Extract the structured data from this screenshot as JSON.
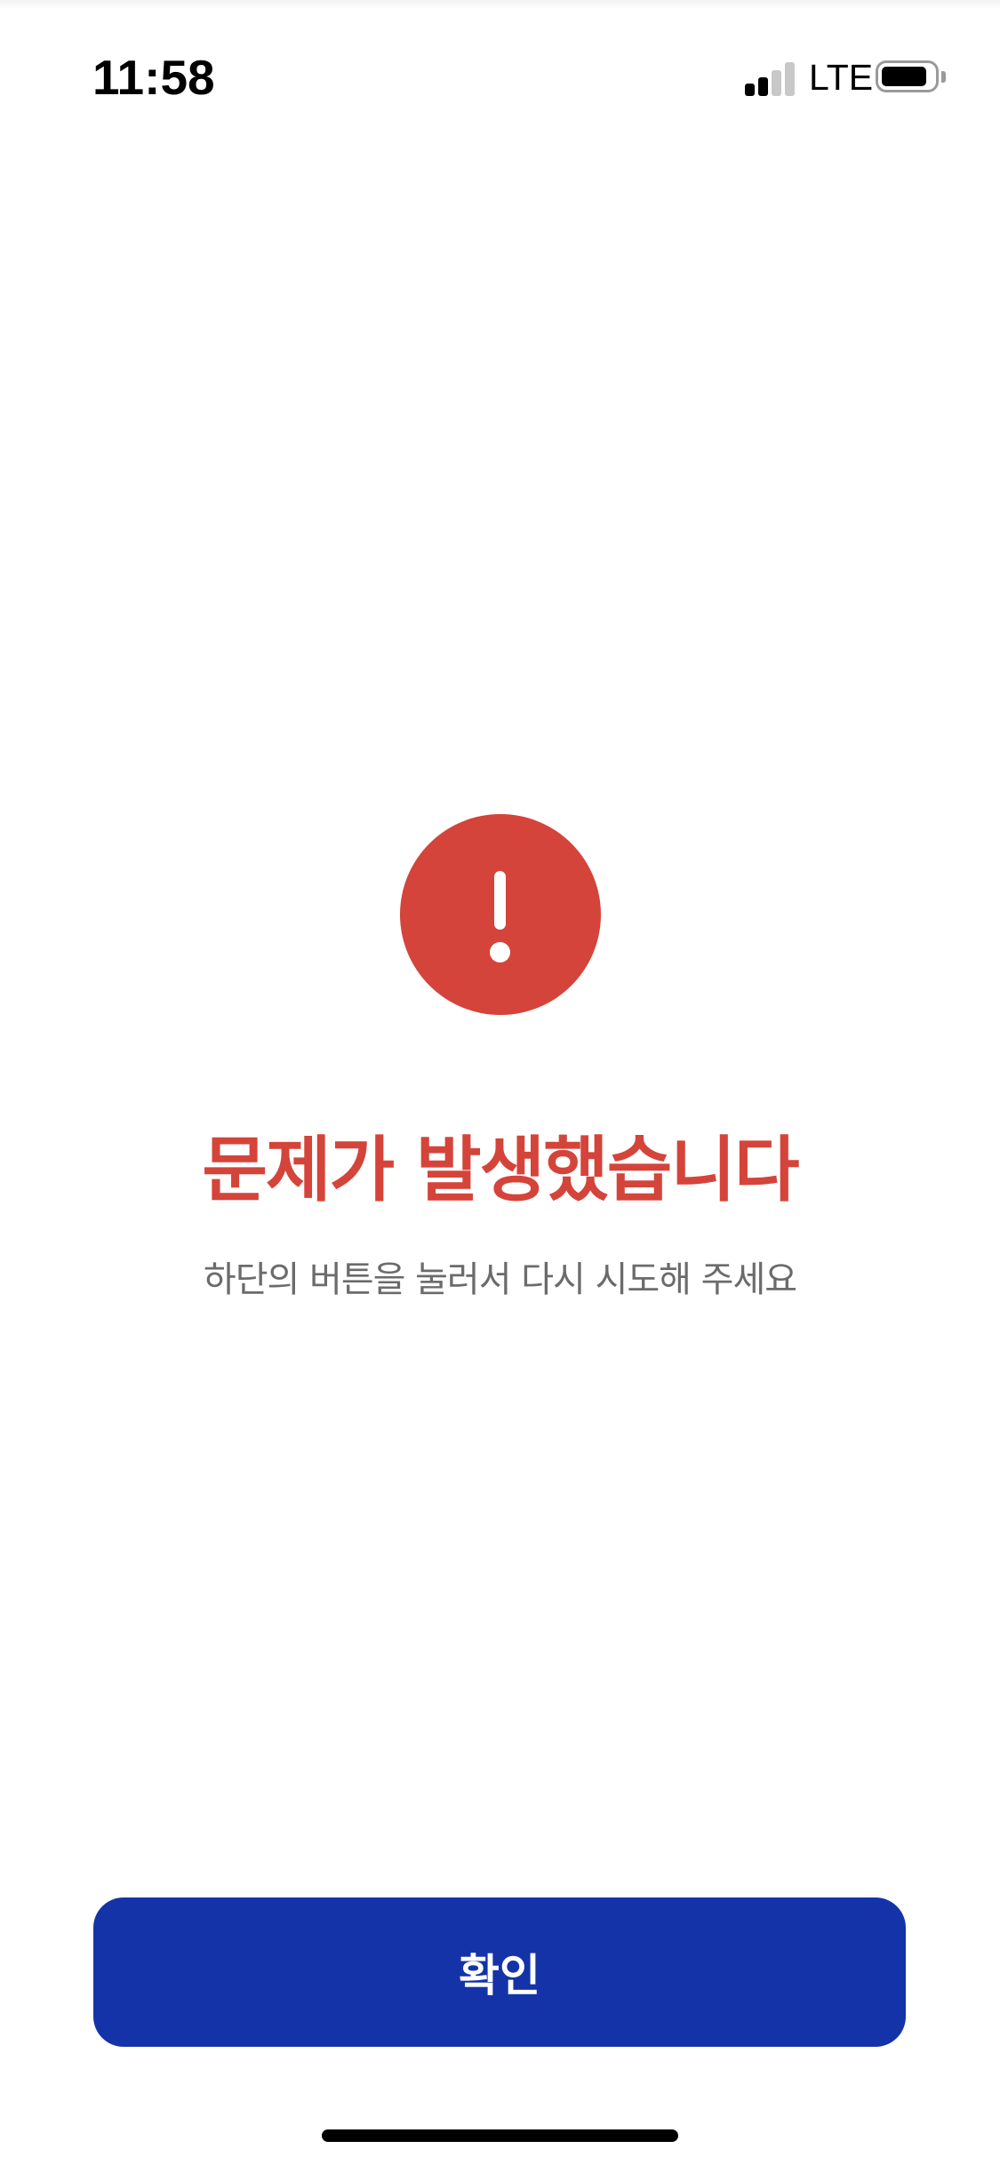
{
  "status_bar": {
    "time": "11:58",
    "network": "LTE",
    "signal_bars_active": 2,
    "signal_bars_total": 4,
    "battery_level": 0.75
  },
  "error": {
    "icon": "exclamation-circle-icon",
    "title": "문제가 발생했습니다",
    "message": "하단의 버튼을 눌러서 다시 시도해 주세요"
  },
  "actions": {
    "confirm_label": "확인"
  },
  "colors": {
    "error": "#d4443a",
    "primary": "#1433a8",
    "message_text": "#6b6b6b"
  }
}
